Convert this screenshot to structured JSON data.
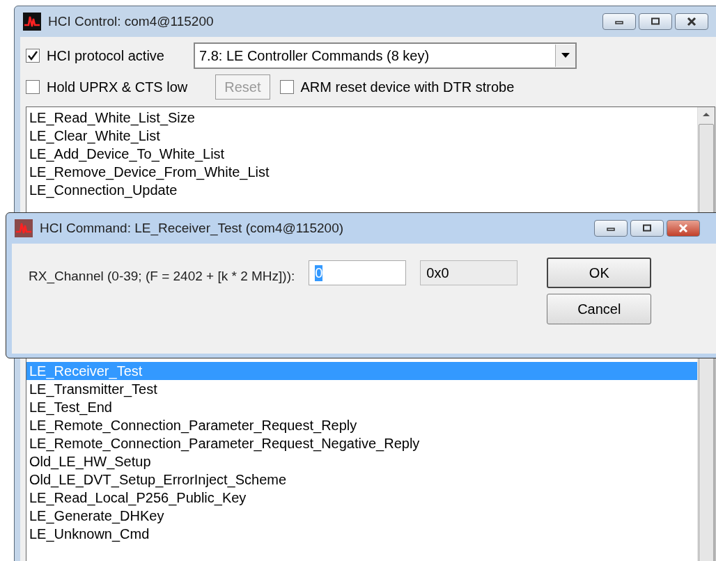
{
  "main_window": {
    "title": "HCI Control: com4@115200",
    "checkboxes_row_1": [
      {
        "label": "HCI protocol active",
        "checked": true
      }
    ],
    "command_group_dropdown": {
      "value": "7.8: LE Controller Commands (8 key)"
    },
    "hold_checkbox": {
      "label": "Hold UPRX & CTS low",
      "checked": false
    },
    "reset_button": {
      "label": "Reset",
      "disabled": true
    },
    "arm_checkbox": {
      "label": "ARM reset device with DTR strobe",
      "checked": false
    },
    "commands_list": {
      "top_items": [
        {
          "label": "LE_Read_White_List_Size",
          "selected": false
        },
        {
          "label": "LE_Clear_White_List",
          "selected": false
        },
        {
          "label": "LE_Add_Device_To_White_List",
          "selected": false
        },
        {
          "label": "LE_Remove_Device_From_White_List",
          "selected": false
        },
        {
          "label": "LE_Connection_Update",
          "selected": false
        }
      ],
      "bottom_items": [
        {
          "label": "LE_Receiver_Test",
          "selected": true
        },
        {
          "label": "LE_Transmitter_Test",
          "selected": false
        },
        {
          "label": "LE_Test_End",
          "selected": false
        },
        {
          "label": "LE_Remote_Connection_Parameter_Request_Reply",
          "selected": false
        },
        {
          "label": "LE_Remote_Connection_Parameter_Request_Negative_Reply",
          "selected": false
        },
        {
          "label": "Old_LE_HW_Setup",
          "selected": false
        },
        {
          "label": "Old_LE_DVT_Setup_ErrorInject_Scheme",
          "selected": false
        },
        {
          "label": "LE_Read_Local_P256_Public_Key",
          "selected": false
        },
        {
          "label": "LE_Generate_DHKey",
          "selected": false
        },
        {
          "label": "LE_Unknown_Cmd",
          "selected": false
        }
      ]
    }
  },
  "dialog": {
    "title": "HCI Command: LE_Receiver_Test (com4@115200)",
    "field_label": "RX_Channel (0-39;  (F = 2402 + [k * 2 MHz])):",
    "field_value": "0",
    "hex_value": "0x0",
    "buttons": [
      "OK",
      "Cancel"
    ]
  }
}
